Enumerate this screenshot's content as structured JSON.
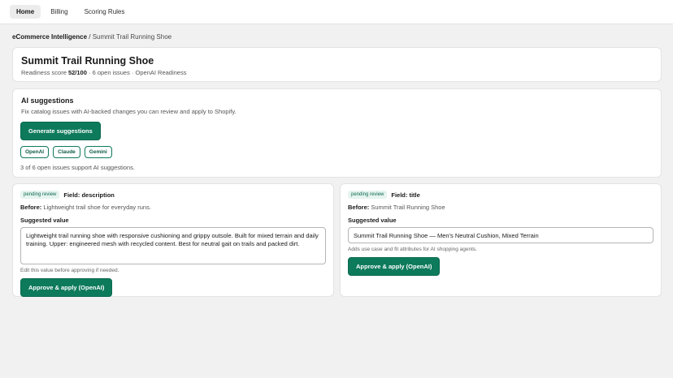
{
  "nav": {
    "tabs": [
      {
        "label": "Home",
        "active": true
      },
      {
        "label": "Billing",
        "active": false
      },
      {
        "label": "Scoring Rules",
        "active": false
      }
    ]
  },
  "breadcrumb": {
    "root": "eCommerce Intelligence",
    "separator": " / ",
    "current": "Summit Trail Running Shoe"
  },
  "product": {
    "title": "Summit Trail Running Shoe",
    "meta_prefix": "Readiness score ",
    "score": "52/100",
    "meta_suffix": " · 6 open issues · OpenAI Readiness"
  },
  "ai": {
    "title": "AI suggestions",
    "description": "Fix catalog issues with AI-backed changes you can review and apply to Shopify.",
    "generate_label": "Generate suggestions",
    "providers": [
      "OpenAI",
      "Claude",
      "Gemini"
    ],
    "support_note": "3 of 6 open issues support AI suggestions."
  },
  "suggestions": [
    {
      "status": "pending review",
      "field": "Field: description",
      "before_label": "Before:",
      "before_value": " Lightweight trail shoe for everyday runs.",
      "suggested_label": "Suggested value",
      "suggested_value": "Lightweight trail running shoe with responsive cushioning and grippy outsole. Built for mixed terrain and daily training. Upper: engineered mesh with recycled content. Best for neutral gait on trails and packed dirt.",
      "hint": "Edit this value before approving if needed.",
      "approve_label": "Approve & apply (OpenAI)"
    },
    {
      "status": "pending review",
      "field": "Field: title",
      "before_label": "Before:",
      "before_value": " Summit Trail Running Shoe",
      "suggested_label": "Suggested value",
      "suggested_value": "Summit Trail Running Shoe — Men's Neutral Cushion, Mixed Terrain",
      "hint": "Adds use case and fit attributes for AI shopping agents.",
      "approve_label": "Approve & apply (OpenAI)"
    }
  ],
  "colors": {
    "accent": "#0d7a5c",
    "background": "#f1f1f2"
  }
}
